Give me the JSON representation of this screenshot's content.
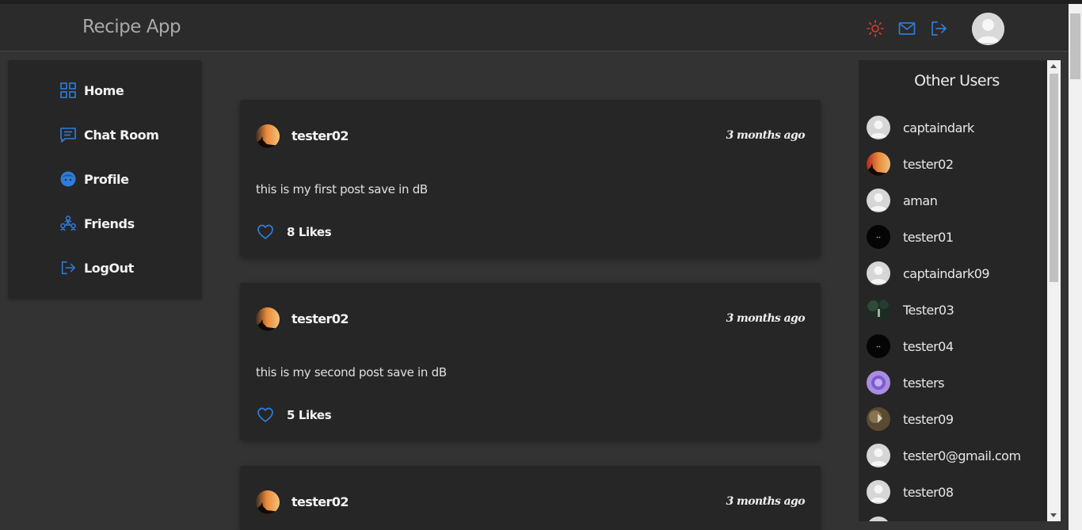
{
  "navbar": {
    "brand": "Recipe App",
    "icons": [
      "sun-icon",
      "mail-icon",
      "logout-icon"
    ],
    "accent": "#2f7dd8",
    "sun_color": "#e03b2f"
  },
  "sidebar": {
    "items": [
      {
        "label": "Home",
        "icon": "grid-icon"
      },
      {
        "label": "Chat Room",
        "icon": "chat-icon"
      },
      {
        "label": "Profile",
        "icon": "face-icon"
      },
      {
        "label": "Friends",
        "icon": "friends-icon"
      },
      {
        "label": "LogOut",
        "icon": "logout-icon"
      }
    ]
  },
  "posts": [
    {
      "author": "tester02",
      "time": "3 months ago",
      "text": "this is my first post save in dB",
      "likes": "8 Likes"
    },
    {
      "author": "tester02",
      "time": "3 months ago",
      "text": "this is my second post save in dB",
      "likes": "5 Likes"
    },
    {
      "author": "tester02",
      "time": "3 months ago",
      "text": "",
      "likes": ""
    }
  ],
  "other_users": {
    "title": "Other Users",
    "users": [
      {
        "name": "captaindark",
        "avatar": "default"
      },
      {
        "name": "tester02",
        "avatar": "photo-sunset"
      },
      {
        "name": "aman",
        "avatar": "default"
      },
      {
        "name": "tester01",
        "avatar": "dark"
      },
      {
        "name": "captaindark09",
        "avatar": "default"
      },
      {
        "name": "Tester03",
        "avatar": "photo-forest"
      },
      {
        "name": "tester04",
        "avatar": "dark"
      },
      {
        "name": "testers",
        "avatar": "photo-purple"
      },
      {
        "name": "tester09",
        "avatar": "photo-brown"
      },
      {
        "name": "tester0@gmail.com",
        "avatar": "default"
      },
      {
        "name": "tester08",
        "avatar": "default"
      }
    ]
  }
}
